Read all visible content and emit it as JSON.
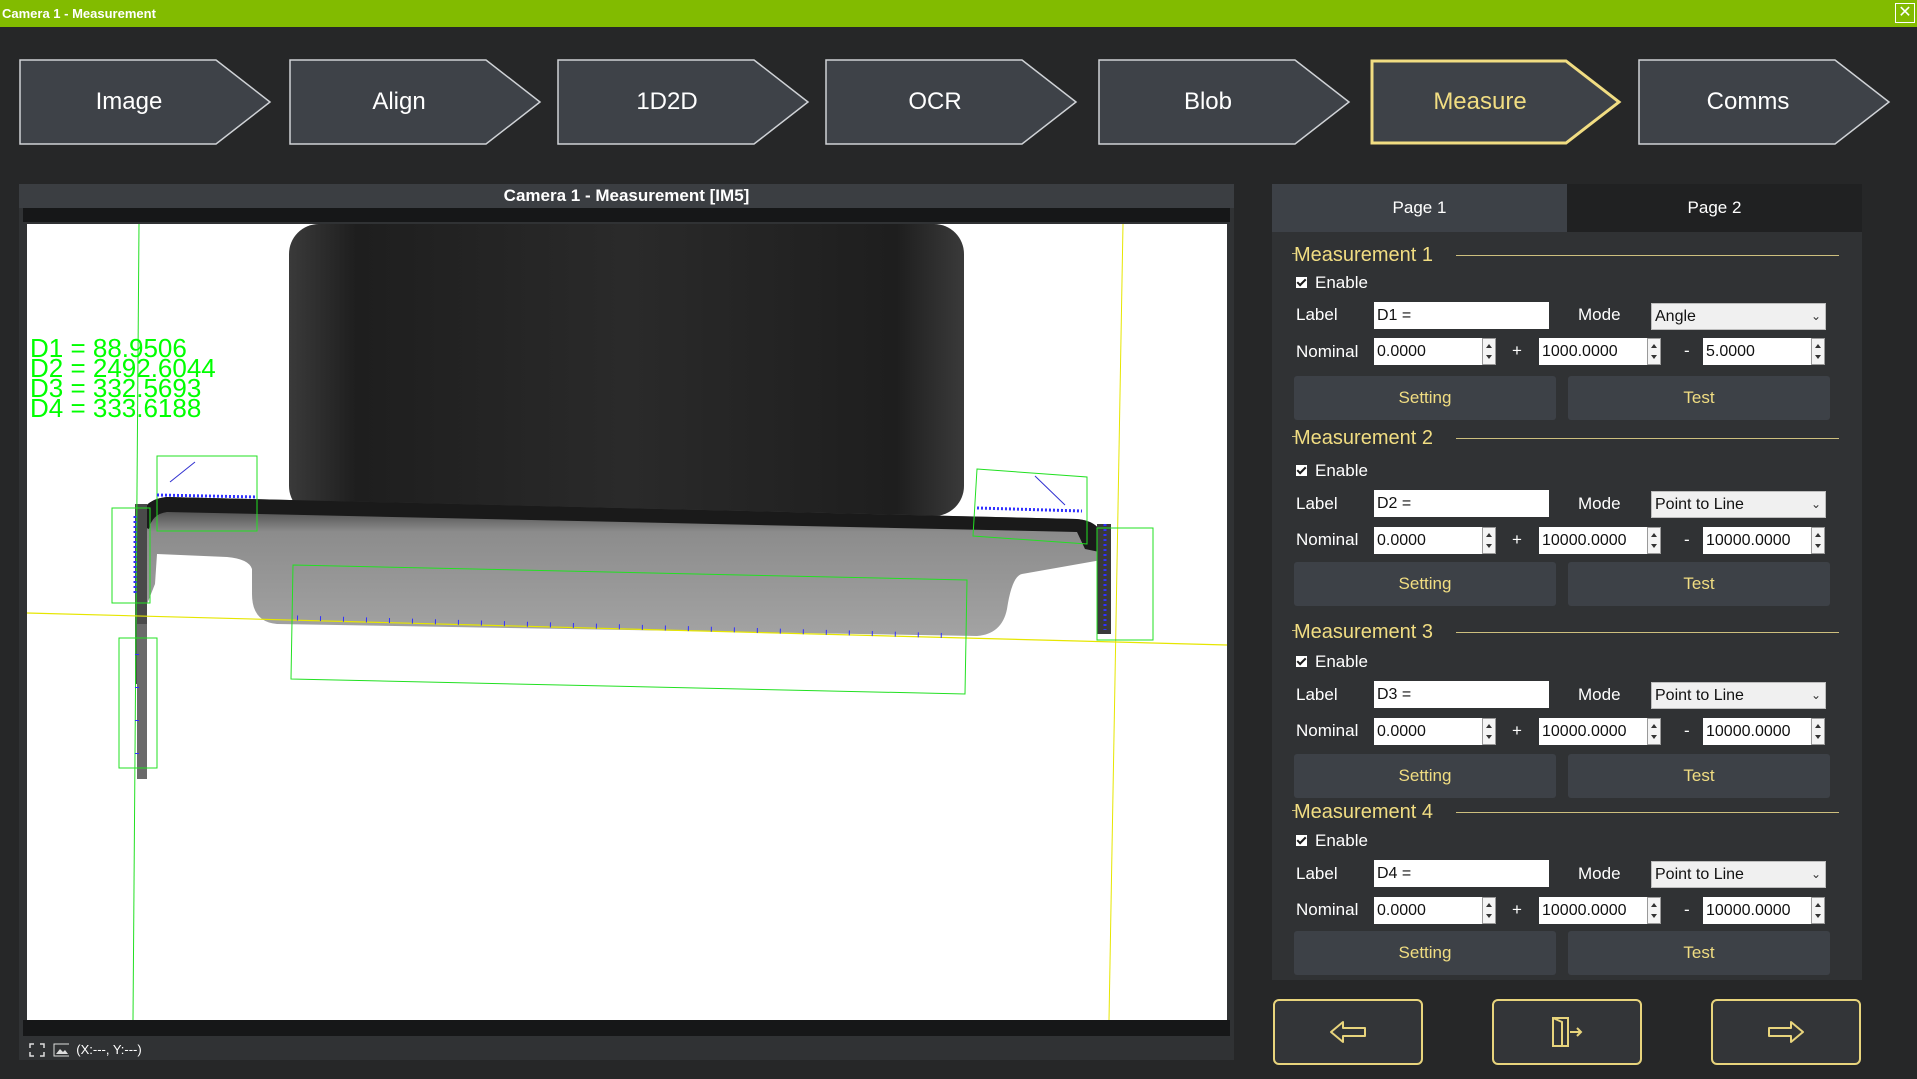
{
  "window": {
    "title": "Camera 1 - Measurement",
    "close_icon": "close-icon"
  },
  "steps": [
    {
      "label": "Image",
      "active": false
    },
    {
      "label": "Align",
      "active": false
    },
    {
      "label": "1D2D",
      "active": false
    },
    {
      "label": "OCR",
      "active": false
    },
    {
      "label": "Blob",
      "active": false
    },
    {
      "label": "Measure",
      "active": true
    },
    {
      "label": "Comms",
      "active": false
    }
  ],
  "camera": {
    "title": "Camera 1 -  Measurement  [IM5]",
    "overlay_results": [
      "D1 = 88.9506",
      "D2 = 2492.6044",
      "D3 = 332.5693",
      "D4 = 333.6188"
    ],
    "coords": "(X:---, Y:---)"
  },
  "pages": {
    "page1": "Page 1",
    "page2": "Page 2",
    "active": "Page 1"
  },
  "fields": {
    "enable": "Enable",
    "label": "Label",
    "mode": "Mode",
    "nominal": "Nominal",
    "plus": "+",
    "minus": "-",
    "setting": "Setting",
    "test": "Test"
  },
  "measurements": [
    {
      "title": "Measurement 1",
      "enabled": true,
      "label": "D1 =",
      "mode": "Angle",
      "nominal": "0.0000",
      "plus_tol": "1000.0000",
      "minus_tol": "5.0000"
    },
    {
      "title": "Measurement 2",
      "enabled": true,
      "label": "D2 =",
      "mode": "Point to Line",
      "nominal": "0.0000",
      "plus_tol": "10000.0000",
      "minus_tol": "10000.0000"
    },
    {
      "title": "Measurement 3",
      "enabled": true,
      "label": "D3 =",
      "mode": "Point to Line",
      "nominal": "0.0000",
      "plus_tol": "10000.0000",
      "minus_tol": "10000.0000"
    },
    {
      "title": "Measurement 4",
      "enabled": true,
      "label": "D4 =",
      "mode": "Point to Line",
      "nominal": "0.0000",
      "plus_tol": "10000.0000",
      "minus_tol": "10000.0000"
    }
  ],
  "nav": {
    "back_icon": "arrow-left-icon",
    "exit_icon": "exit-icon",
    "next_icon": "arrow-right-icon"
  },
  "colors": {
    "title_bar": "#82bb00",
    "accent": "#f1dd82",
    "overlay_text": "#00ff00"
  }
}
